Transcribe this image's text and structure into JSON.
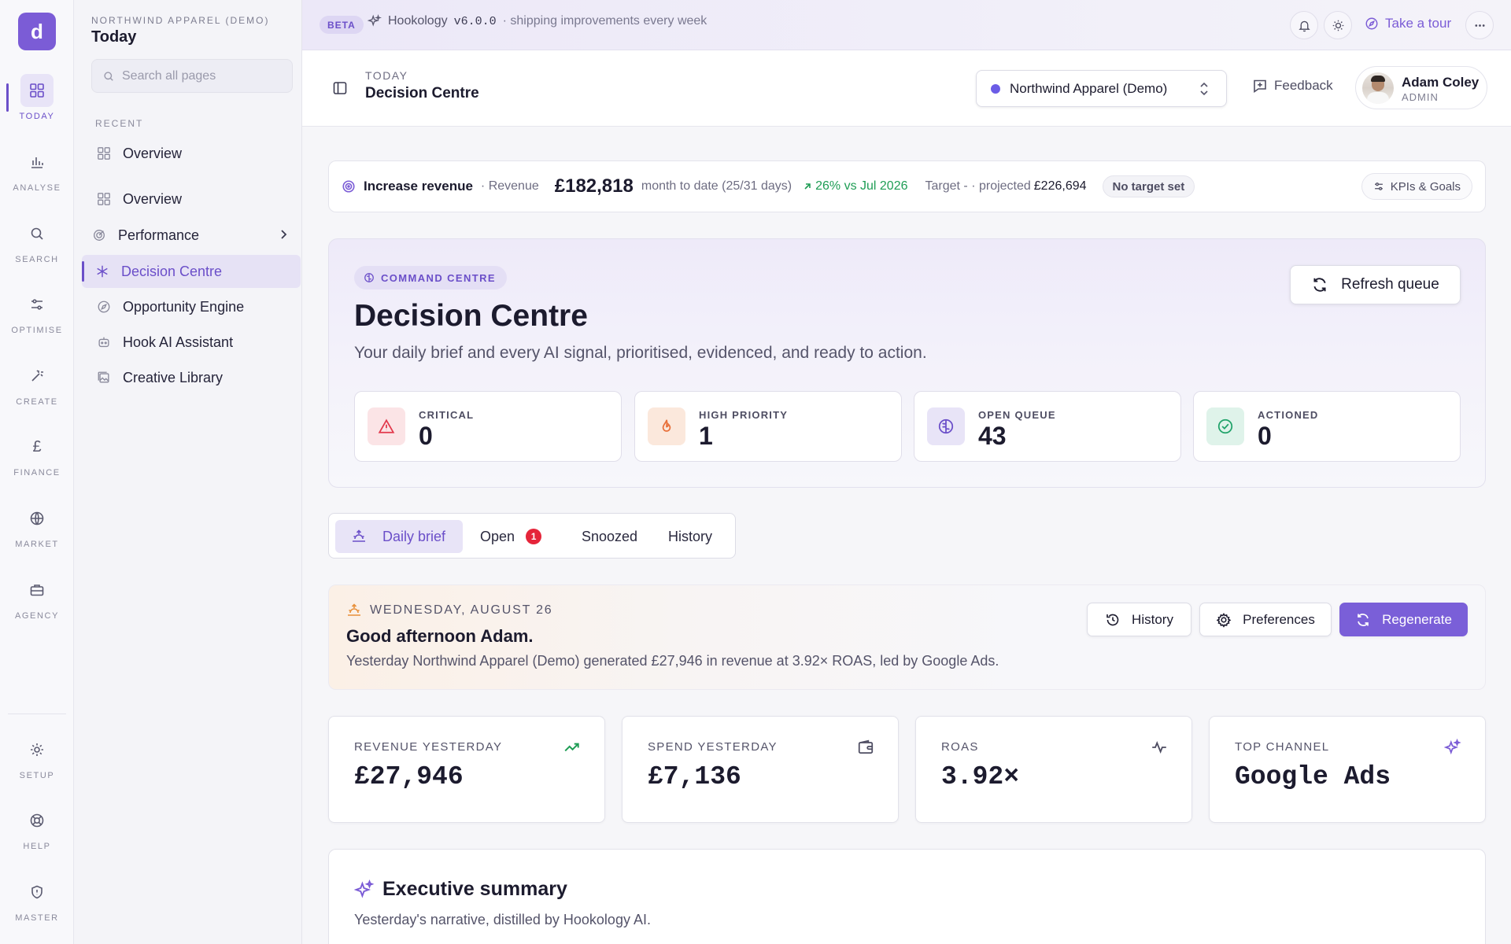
{
  "rail": {
    "logo_glyph": "d",
    "items": [
      {
        "label": "TODAY",
        "icon": "grid-icon"
      },
      {
        "label": "ANALYSE",
        "icon": "bar-chart-icon"
      },
      {
        "label": "SEARCH",
        "icon": "search-icon"
      },
      {
        "label": "OPTIMISE",
        "icon": "sliders-icon"
      },
      {
        "label": "CREATE",
        "icon": "magic-wand-icon"
      },
      {
        "label": "FINANCE",
        "icon": "pound-icon"
      },
      {
        "label": "MARKET",
        "icon": "globe-icon"
      },
      {
        "label": "AGENCY",
        "icon": "briefcase-icon"
      }
    ],
    "bottom_items": [
      {
        "label": "SETUP",
        "icon": "sun-gear-icon"
      },
      {
        "label": "HELP",
        "icon": "lifebuoy-icon"
      },
      {
        "label": "MASTER",
        "icon": "shield-icon"
      }
    ]
  },
  "sidebar": {
    "org": "NORTHWIND APPAREL (DEMO)",
    "title": "Today",
    "search_placeholder": "Search all pages",
    "recent_label": "RECENT",
    "recent_items": [
      {
        "label": "Overview"
      }
    ],
    "items": [
      {
        "label": "Overview"
      },
      {
        "label": "Performance"
      },
      {
        "label": "Decision Centre"
      },
      {
        "label": "Opportunity Engine"
      },
      {
        "label": "Hook AI Assistant"
      },
      {
        "label": "Creative Library"
      }
    ]
  },
  "topbar": {
    "beta": "BETA",
    "app": "Hookology",
    "version": "v6.0.0",
    "tagline": "· shipping improvements every week",
    "tour": "Take a tour"
  },
  "header": {
    "crumb": "TODAY",
    "title": "Decision Centre",
    "org_select": "Northwind Apparel (Demo)",
    "feedback": "Feedback",
    "user_name": "Adam Coley",
    "user_role": "ADMIN"
  },
  "kpi": {
    "goal": "Increase revenue",
    "metric": "· Revenue",
    "value": "£182,818",
    "period": "month to date (25/31 days)",
    "delta": "26% vs Jul 2026",
    "target": "Target - · projected",
    "projected": "£226,694",
    "no_target": "No target set",
    "button": "KPIs & Goals"
  },
  "hero": {
    "badge": "COMMAND CENTRE",
    "title": "Decision Centre",
    "subtitle": "Your daily brief and every AI signal, prioritised, evidenced, and ready to action.",
    "refresh": "Refresh queue",
    "stats": [
      {
        "label": "CRITICAL",
        "value": "0"
      },
      {
        "label": "HIGH PRIORITY",
        "value": "1"
      },
      {
        "label": "OPEN QUEUE",
        "value": "43"
      },
      {
        "label": "ACTIONED",
        "value": "0"
      }
    ]
  },
  "tabs": {
    "daily": "Daily brief",
    "open": "Open",
    "open_count": "1",
    "snoozed": "Snoozed",
    "history": "History"
  },
  "brief": {
    "date": "WEDNESDAY, AUGUST 26",
    "greeting": "Good afternoon Adam.",
    "summary": "Yesterday Northwind Apparel (Demo) generated £27,946 in revenue at 3.92× ROAS, led by Google Ads.",
    "history_btn": "History",
    "prefs_btn": "Preferences",
    "regen_btn": "Regenerate"
  },
  "metrics": [
    {
      "label": "REVENUE YESTERDAY",
      "value": "£27,946",
      "icon": "trending-up-icon"
    },
    {
      "label": "SPEND YESTERDAY",
      "value": "£7,136",
      "icon": "wallet-icon"
    },
    {
      "label": "ROAS",
      "value": "3.92×",
      "icon": "pulse-icon"
    },
    {
      "label": "TOP CHANNEL",
      "value": "Google Ads",
      "icon": "sparkles-icon"
    }
  ],
  "exec": {
    "title": "Executive summary",
    "subtitle": "Yesterday's narrative, distilled by Hookology AI."
  },
  "colors": {
    "accent": "#7b5cd6",
    "positive": "#1f9d55",
    "critical": "#e5253a"
  }
}
